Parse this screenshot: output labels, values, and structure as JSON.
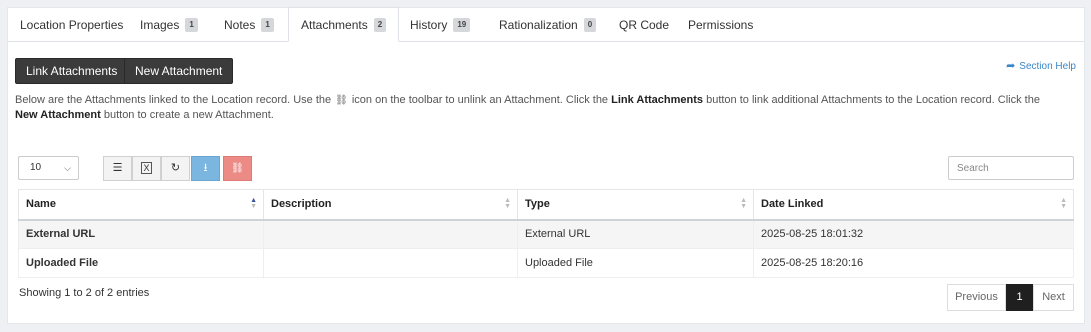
{
  "tabs": [
    {
      "label": "Location Properties",
      "badge": null
    },
    {
      "label": "Images",
      "badge": "1"
    },
    {
      "label": "Notes",
      "badge": "1"
    },
    {
      "label": "Attachments",
      "badge": "2"
    },
    {
      "label": "History",
      "badge": "19"
    },
    {
      "label": "Rationalization",
      "badge": "0"
    },
    {
      "label": "QR Code",
      "badge": null
    },
    {
      "label": "Permissions",
      "badge": null
    }
  ],
  "active_tab": "Attachments",
  "buttons": {
    "link_attachments": "Link Attachments",
    "new_attachment": "New Attachment"
  },
  "section_help": "Section Help",
  "description": {
    "part1": "Below are the Attachments linked to the Location record. Use the",
    "part2": "icon on the toolbar to unlink an Attachment. Click the",
    "bold1": "Link Attachments",
    "part3": "button to link additional Attachments to the Location record. Click the",
    "bold2": "New Attachment",
    "part4": "button to create a new Attachment."
  },
  "page_length": "10",
  "search_placeholder": "Search",
  "table": {
    "columns": [
      "Name",
      "Description",
      "Type",
      "Date Linked"
    ],
    "rows": [
      {
        "name": "External URL",
        "description": "",
        "type": "External URL",
        "date_linked": "2025-08-25 18:01:32"
      },
      {
        "name": "Uploaded File",
        "description": "",
        "type": "Uploaded File",
        "date_linked": "2025-08-25 18:20:16"
      }
    ]
  },
  "info": "Showing 1 to 2 of 2 entries",
  "pagination": {
    "previous": "Previous",
    "current": "1",
    "next": "Next"
  },
  "icons": {
    "unlink": "unlink-icon",
    "list": "list-icon",
    "excel": "excel-icon",
    "refresh": "refresh-icon",
    "download": "download-icon",
    "unlink_toolbar": "unlink-icon"
  }
}
